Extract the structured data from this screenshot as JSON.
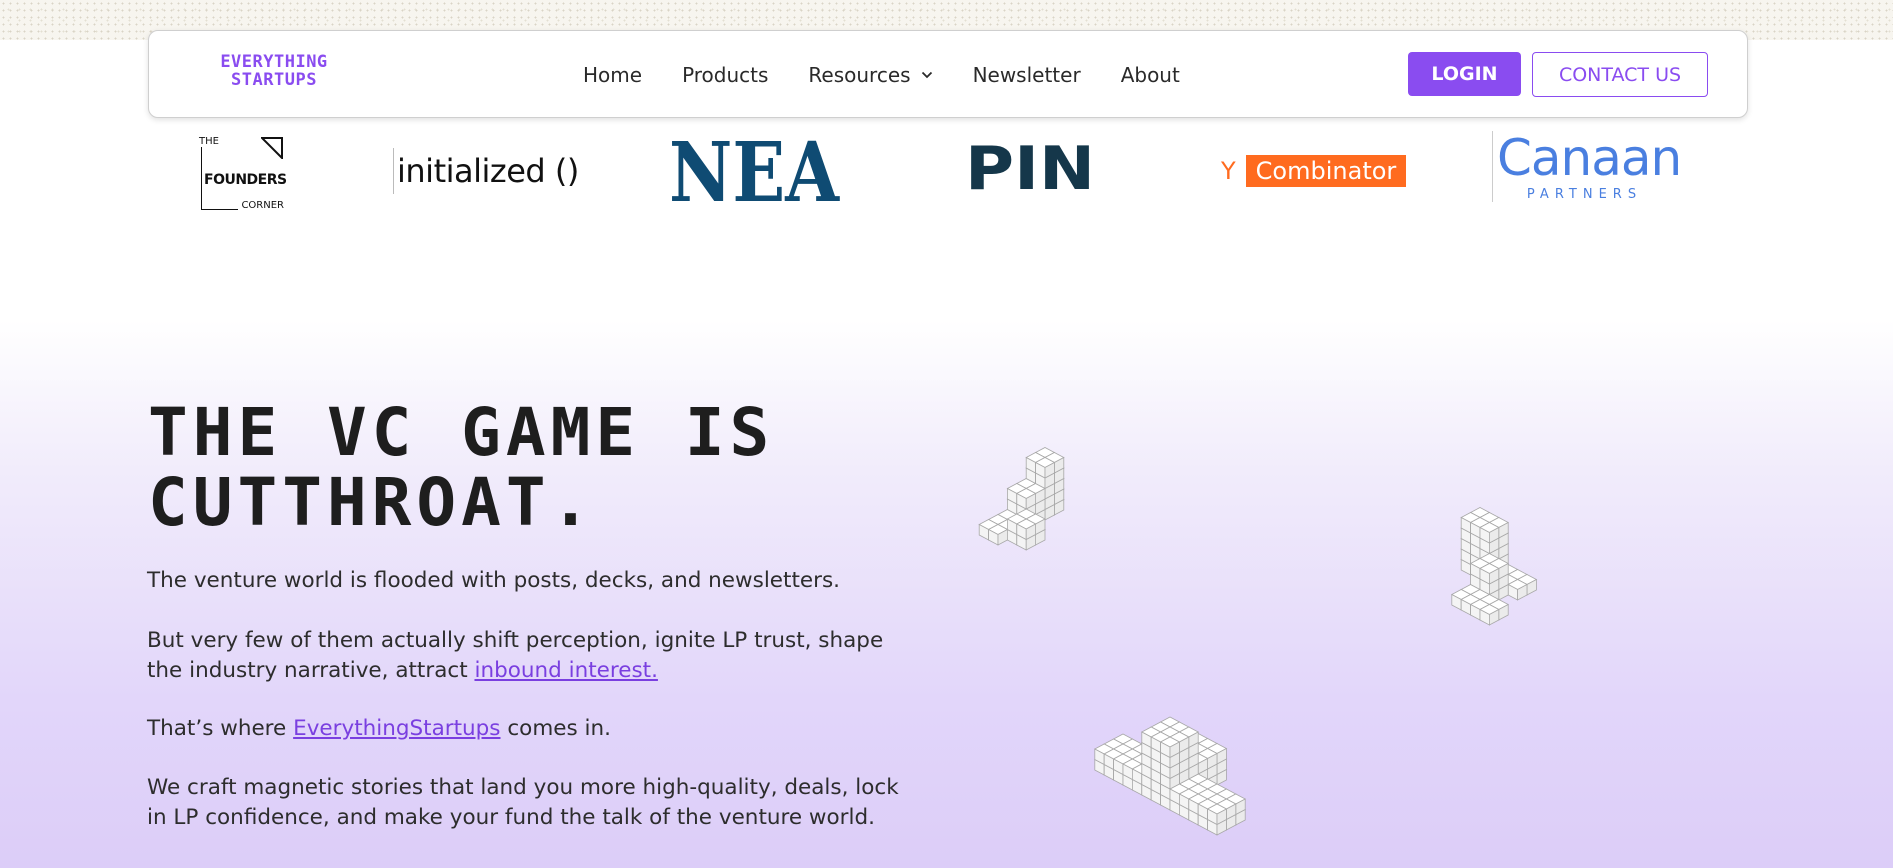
{
  "brand": {
    "logo_line1": "EVERYTHING",
    "logo_line2": "STARTUPS",
    "accent_color": "#8a4cf0"
  },
  "nav": {
    "links": [
      "Home",
      "Products",
      "Resources",
      "Newsletter",
      "About"
    ],
    "resources_icon": "chevron-down-icon",
    "login_label": "LOGIN",
    "contact_label": "CONTACT US"
  },
  "partner_logos": {
    "founders_corner": {
      "line1": "THE",
      "line2": "FOUNDERS",
      "line3": "CORNER"
    },
    "initialized": "initialized ()",
    "nea": "NEA",
    "pin": "PIN",
    "ycombinator": {
      "y": "Y",
      "name": "Combinator"
    },
    "canaan": {
      "name": "Canaan",
      "sub": "PARTNERS"
    }
  },
  "hero": {
    "title": "THE VC GAME IS CUTTHROAT.",
    "p1": "The venture world is flooded with posts, decks, and newsletters.",
    "p2_text": "But very few of them actually shift perception, ignite LP trust, shape the industry narrative, attract ",
    "p2_link": "inbound interest.",
    "p3_before": "That’s where ",
    "p3_link": "EverythingStartups",
    "p3_after": " comes in.",
    "p4": "We craft magnetic stories that land you more high-quality, deals, lock in LP confidence, and make your fund the talk of the venture world."
  }
}
